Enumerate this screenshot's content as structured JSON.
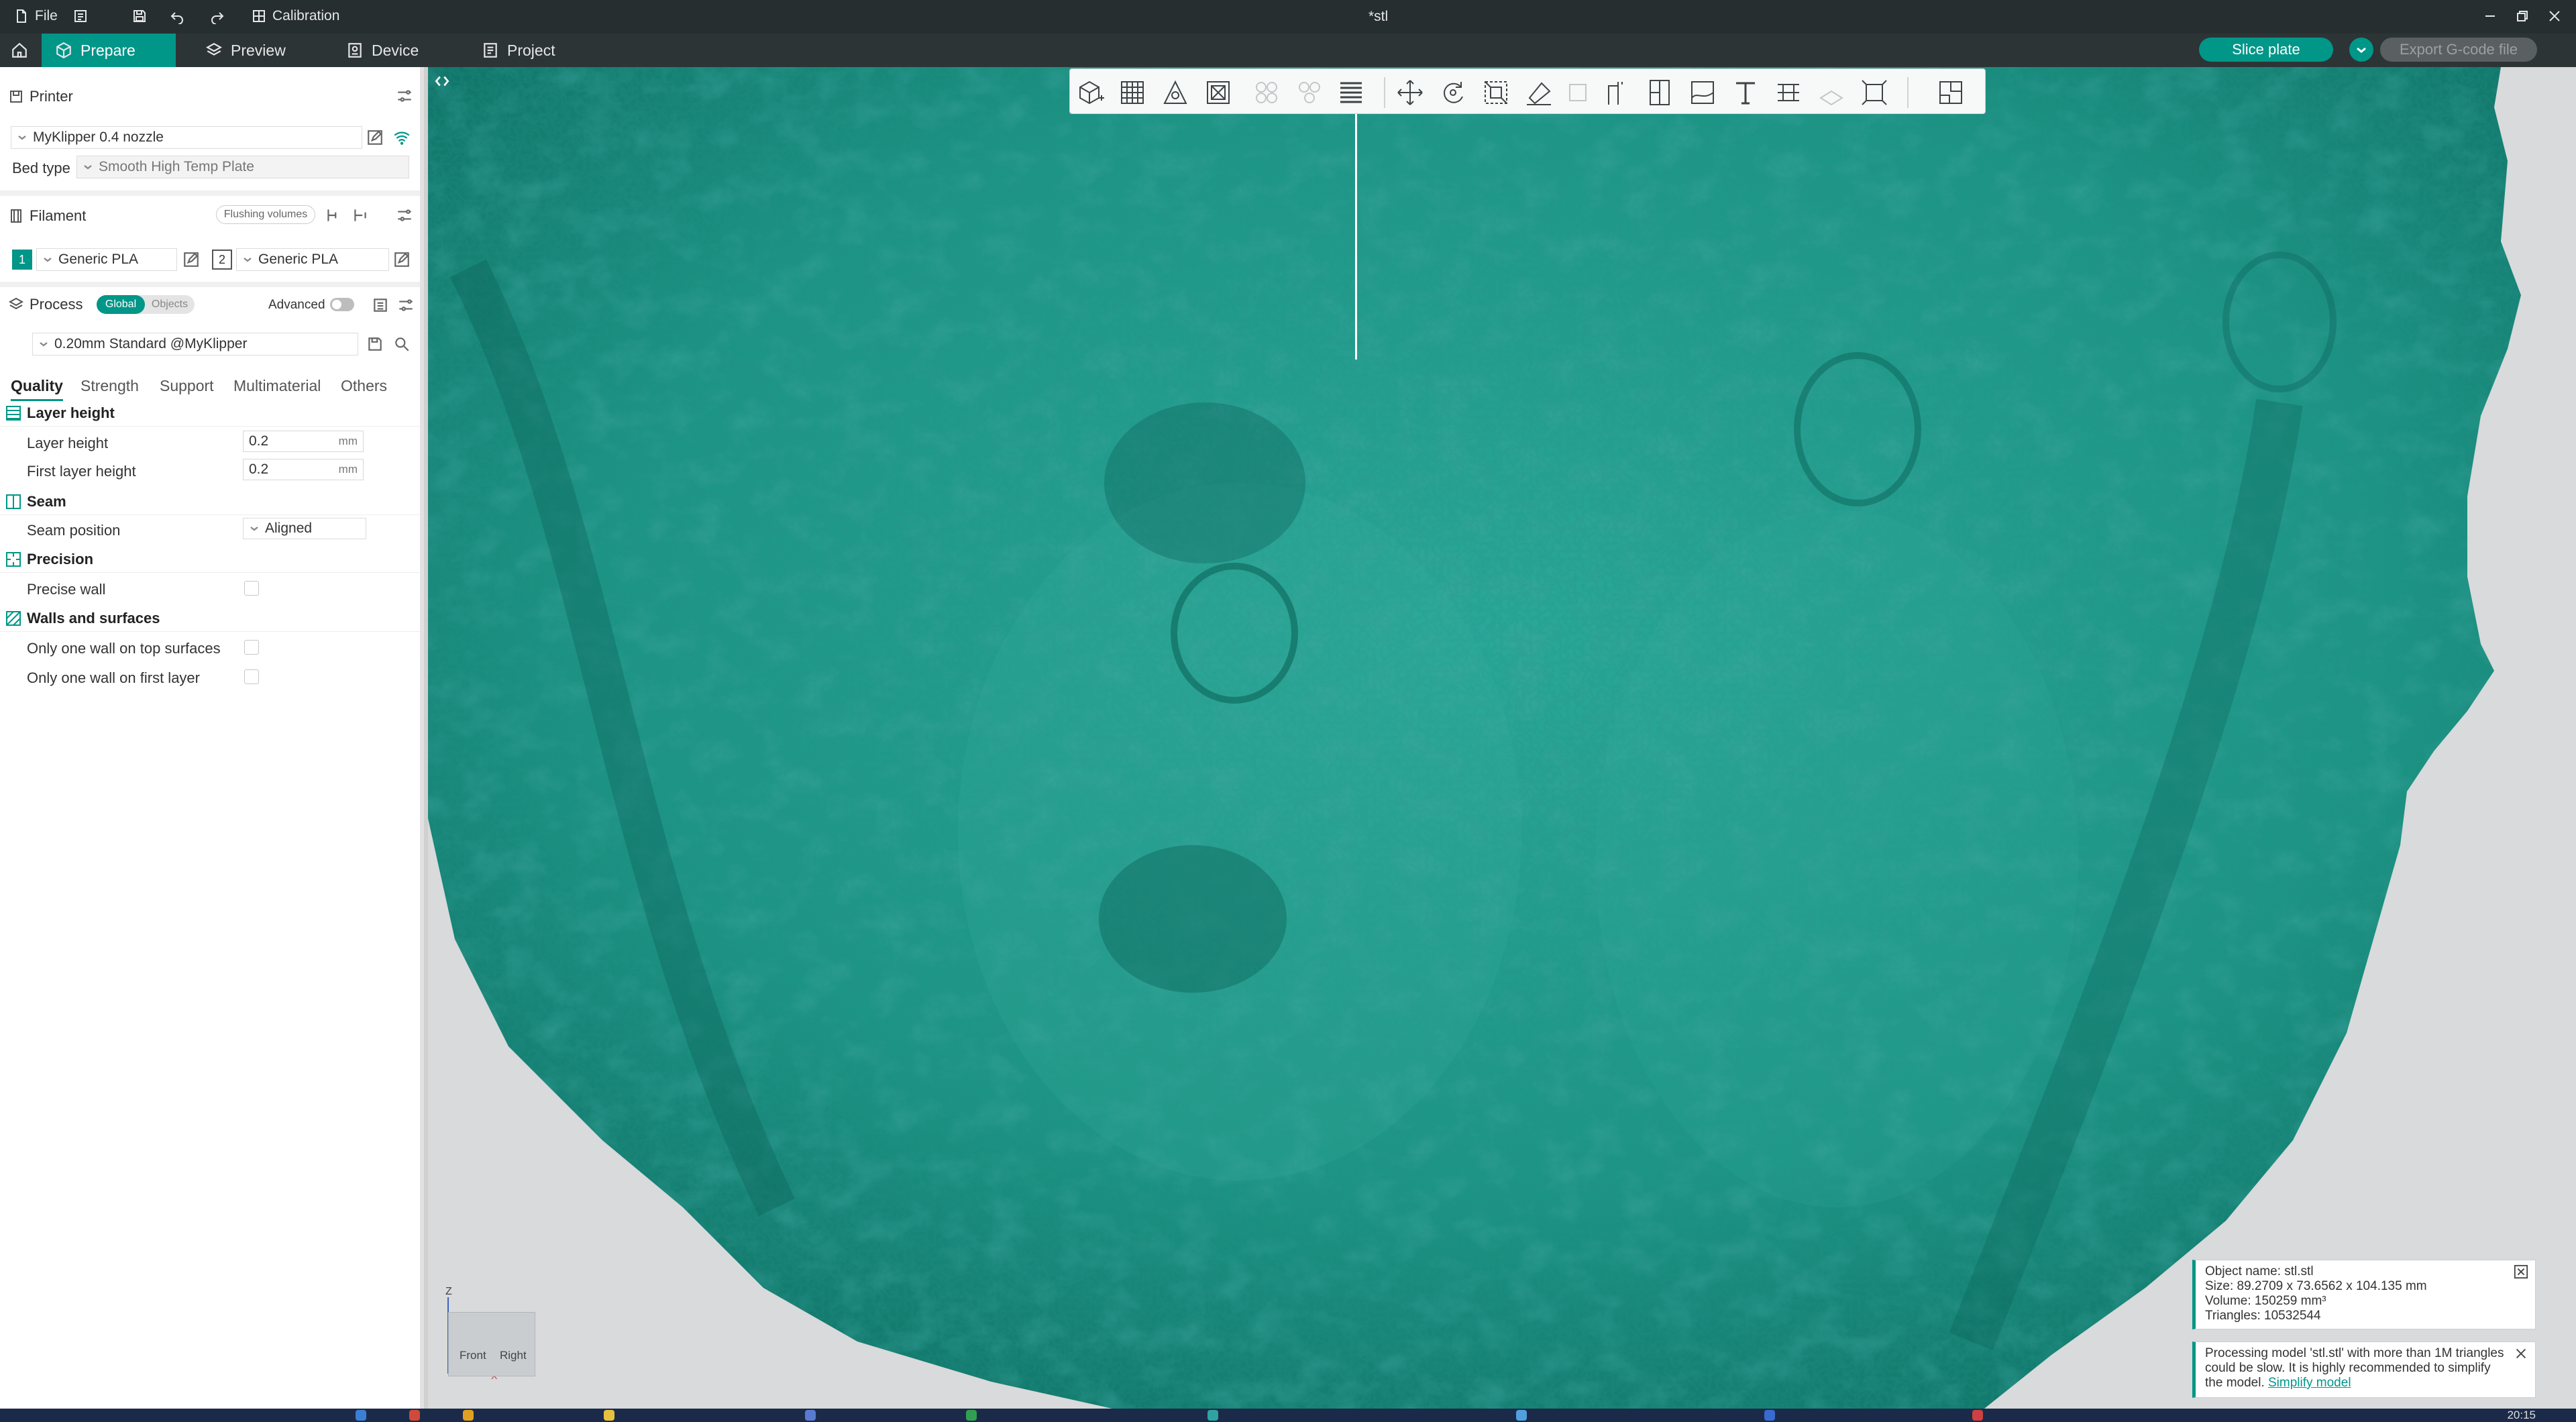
{
  "titlebar": {
    "file_menu": "File",
    "calibration_label": "Calibration",
    "document_title": "*stl"
  },
  "nav": {
    "tabs": [
      {
        "label": "Prepare",
        "icon": "cube-icon",
        "active": true
      },
      {
        "label": "Preview",
        "icon": "layers-icon",
        "active": false
      },
      {
        "label": "Device",
        "icon": "device-icon",
        "active": false
      },
      {
        "label": "Project",
        "icon": "project-icon",
        "active": false
      }
    ],
    "slice_button": "Slice plate",
    "export_button": "Export G-code file"
  },
  "printer": {
    "section_title": "Printer",
    "printer_name": "MyKlipper 0.4 nozzle",
    "bed_type_label": "Bed type",
    "bed_type_value": "Smooth High Temp Plate"
  },
  "filament": {
    "section_title": "Filament",
    "flushing_button": "Flushing volumes",
    "slots": [
      {
        "index": "1",
        "name": "Generic PLA"
      },
      {
        "index": "2",
        "name": "Generic PLA"
      }
    ]
  },
  "process": {
    "section_title": "Process",
    "global_label": "Global",
    "objects_label": "Objects",
    "advanced_label": "Advanced",
    "advanced_on": false,
    "profile": "0.20mm Standard @MyKlipper"
  },
  "settings_tabs": [
    "Quality",
    "Strength",
    "Support",
    "Multimaterial",
    "Others"
  ],
  "quality": {
    "layer_height_group": "Layer height",
    "layer_height_label": "Layer height",
    "layer_height_value": "0.2",
    "first_layer_height_label": "First layer height",
    "first_layer_height_value": "0.2",
    "unit": "mm",
    "seam_group": "Seam",
    "seam_position_label": "Seam position",
    "seam_position_value": "Aligned",
    "precision_group": "Precision",
    "precise_wall_label": "Precise wall",
    "walls_group": "Walls and surfaces",
    "one_wall_top_label": "Only one wall on top surfaces",
    "one_wall_first_label": "Only one wall on first layer"
  },
  "orientation": {
    "z_label": "Z",
    "front_label": "Front",
    "right_label": "Right",
    "x_label": "X"
  },
  "notifications": {
    "object_info": {
      "name": "Object name: stl.stl",
      "size": "Size: 89.2709 x 73.6562 x 104.135 mm",
      "volume": "Volume: 150259 mm³",
      "triangles": "Triangles: 10532544"
    },
    "warning": {
      "line1": "Processing model 'stl.stl' with more than 1M triangles",
      "line2": "could be slow. It is highly recommended to simplify",
      "line3_prefix": "the model. ",
      "link": "Simplify model"
    }
  },
  "taskbar": {
    "clock": "20:15"
  },
  "colors": {
    "accent": "#009688",
    "model": "#1e9a8a",
    "titlebar": "#262e30"
  }
}
